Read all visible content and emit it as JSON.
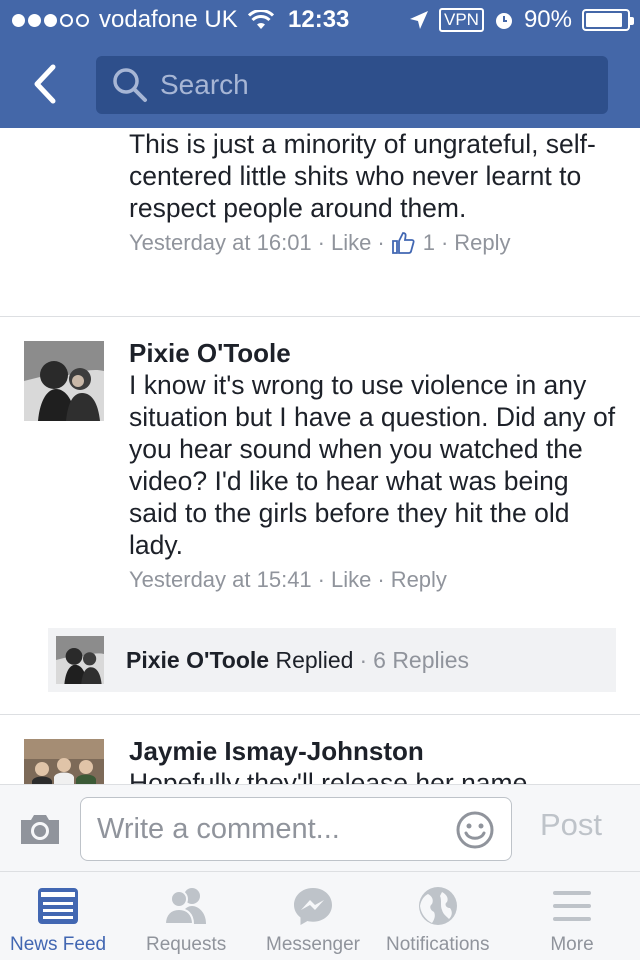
{
  "status_bar": {
    "carrier": "vodafone UK",
    "time": "12:33",
    "vpn": "VPN",
    "battery": "90%",
    "battery_level": 0.9
  },
  "header": {
    "search_placeholder": "Search",
    "back_icon": "chevron-left-icon",
    "search_icon": "search-icon"
  },
  "comments": [
    {
      "text": "This is just a minority of ungrateful, self-centered little shits who never learnt to respect people around them.",
      "time": "Yesterday at 16:01",
      "like": "Like",
      "like_count": "1",
      "reply": "Reply"
    },
    {
      "name": "Pixie O'Toole",
      "text": "I know it's wrong to use violence in any situation but I have a question. Did any of you hear sound when you watched the video? I'd like to hear what was being said to the girls before they hit the old lady.",
      "time": "Yesterday at 15:41",
      "like": "Like",
      "reply": "Reply",
      "replies": {
        "name": "Pixie O'Toole",
        "action": "Replied",
        "count": "6 Replies"
      }
    },
    {
      "name": "Jaymie Ismay-Johnston",
      "text": "Hopefully they'll release her name"
    }
  ],
  "composer": {
    "placeholder": "Write a comment...",
    "post": "Post"
  },
  "tabs": [
    {
      "label": "News Feed",
      "icon": "news-feed-icon",
      "active": true
    },
    {
      "label": "Requests",
      "icon": "friend-requests-icon",
      "active": false
    },
    {
      "label": "Messenger",
      "icon": "messenger-icon",
      "active": false
    },
    {
      "label": "Notifications",
      "icon": "globe-icon",
      "active": false
    },
    {
      "label": "More",
      "icon": "hamburger-menu-icon",
      "active": false
    }
  ],
  "colors": {
    "header_bg": "#4467a8",
    "accent": "#4267b2",
    "meta_gray": "#90949c"
  }
}
